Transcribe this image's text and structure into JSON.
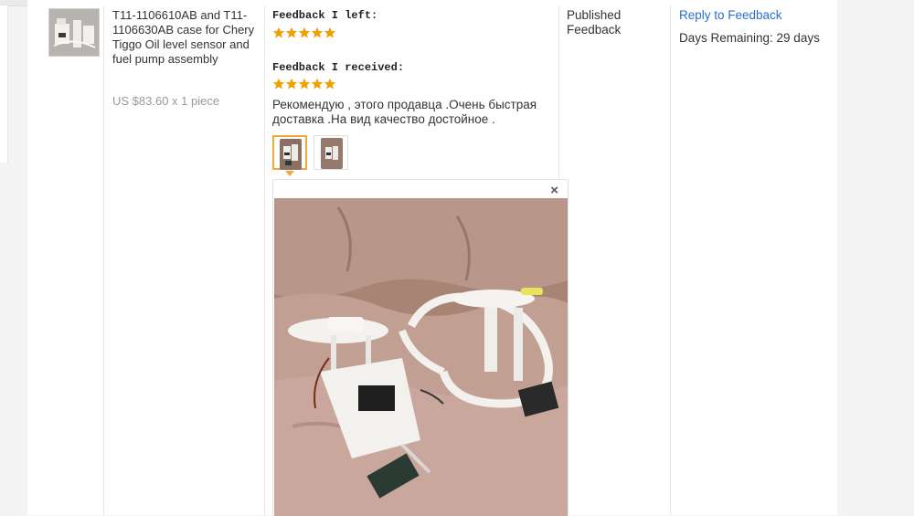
{
  "order": {
    "product": {
      "title": "T11-1106610AB and T11-1106630AB case for Chery Tiggo Oil level sensor and fuel pump assembly",
      "price": "US $83.60 x 1 piece",
      "thumbnail_icon": "product-photo-icon"
    },
    "feedback": {
      "left_label": "Feedback I left:",
      "left_rating": 5,
      "received_label": "Feedback I received:",
      "received_rating": 5,
      "received_text": "Рекомендую , этого продавца .Очень быстрая доставка .На вид качество достойное .",
      "photos": [
        "photo-1",
        "photo-2"
      ],
      "selected_photo": 0,
      "close_label": "×"
    },
    "status": {
      "text": "Published Feedback"
    },
    "actions": {
      "reply_label": "Reply to Feedback",
      "days_remaining": "Days Remaining: 29 days"
    }
  },
  "colors": {
    "accent_link": "#2a6fcc",
    "star": "#f0a000",
    "selected_border": "#f0a93b",
    "muted_price": "#999999"
  }
}
